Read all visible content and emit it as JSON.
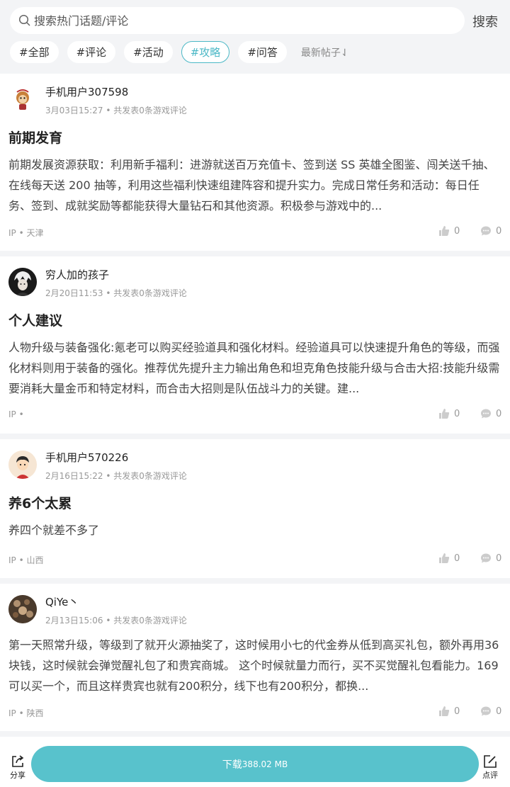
{
  "search": {
    "placeholder": "搜索热门话题/评论",
    "button": "搜索"
  },
  "tags": [
    "#全部",
    "#评论",
    "#活动",
    "#攻略",
    "#问答"
  ],
  "active_tag": "#攻略",
  "sort_label": "最新帖子⇃",
  "posts": [
    {
      "user": "手机用户307598",
      "date": "3月03日15:27",
      "meta": " • 共发表0条游戏评论",
      "title": "前期发育",
      "body": "前期发展资源获取：利用新手福利：进游就送百万充值卡、签到送 SS 英雄全图鉴、闯关送千抽、在线每天送 200 抽等，利用这些福利快速组建阵容和提升实力。完成日常任务和活动：每日任务、签到、成就奖励等都能获得大量钻石和其他资源。积极参与游戏中的...",
      "ip": "IP • 天津",
      "likes": "0",
      "comments": "0"
    },
    {
      "user": "穷人加的孩子",
      "date": "2月20日11:53",
      "meta": " • 共发表0条游戏评论",
      "title": "个人建议",
      "body": "人物升级与装备强化:氪老可以购买经验道具和强化材料。经验道具可以快速提升角色的等级，而强化材料则用于装备的强化。推荐优先提升主力输出角色和坦克角色技能升级与合击大招:技能升级需要消耗大量金币和特定材料，而合击大招则是队伍战斗力的关键。建...",
      "ip": "IP •",
      "likes": "0",
      "comments": "0"
    },
    {
      "user": "手机用户570226",
      "date": "2月16日15:22",
      "meta": " • 共发表0条游戏评论",
      "title": "养6个太累",
      "body": "养四个就差不多了",
      "ip": "IP • 山西",
      "likes": "0",
      "comments": "0"
    },
    {
      "user": "QiYe丶",
      "date": "2月13日15:06",
      "meta": " • 共发表0条游戏评论",
      "title": "",
      "body": "第一天照常升级，等级到了就开火源抽奖了，这时候用小七的代金券从低到高买礼包，额外再用36块钱，这时候就会弹觉醒礼包了和贵宾商城。 这个时候就量力而行，买不买觉醒礼包看能力。169可以买一个，而且这样贵宾也就有200积分，线下也有200积分，都换...",
      "ip": "IP • 陕西",
      "likes": "0",
      "comments": "0"
    }
  ],
  "bottom": {
    "share": "分享",
    "download": "下载",
    "size": "388.02 MB",
    "review": "点评"
  },
  "colors": {
    "accent": "#58c2cc",
    "tag_active": "#4bb8c6"
  }
}
